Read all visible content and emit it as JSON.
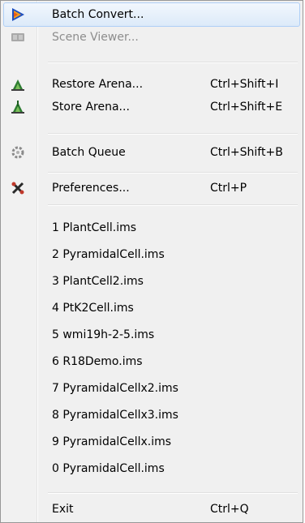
{
  "menu": {
    "items": [
      {
        "id": "batch-convert",
        "label": "Batch Convert...",
        "shortcut": "",
        "icon": "batch-convert-icon",
        "enabled": true,
        "highlighted": true
      },
      {
        "id": "scene-viewer",
        "label": "Scene Viewer...",
        "shortcut": "",
        "icon": "scene-viewer-icon",
        "enabled": false
      },
      {
        "id": "restore-arena",
        "label": "Restore Arena...",
        "shortcut": "Ctrl+Shift+I",
        "icon": "restore-arena-icon",
        "enabled": true
      },
      {
        "id": "store-arena",
        "label": "Store Arena...",
        "shortcut": "Ctrl+Shift+E",
        "icon": "store-arena-icon",
        "enabled": true
      },
      {
        "id": "batch-queue",
        "label": "Batch Queue",
        "shortcut": "Ctrl+Shift+B",
        "icon": "batch-queue-icon",
        "enabled": true
      },
      {
        "id": "preferences",
        "label": "Preferences...",
        "shortcut": "Ctrl+P",
        "icon": "preferences-icon",
        "enabled": true
      }
    ],
    "recent_files": [
      "1 PlantCell.ims",
      "2 PyramidalCell.ims",
      "3 PlantCell2.ims",
      "4 PtK2Cell.ims",
      "5 wmi19h-2-5.ims",
      "6 R18Demo.ims",
      "7 PyramidalCellx2.ims",
      "8 PyramidalCellx3.ims",
      "9 PyramidalCellx.ims",
      "0 PyramidalCell.ims"
    ],
    "exit": {
      "label": "Exit",
      "shortcut": "Ctrl+Q"
    }
  },
  "colors": {
    "highlight_border": "#aecff7",
    "highlight_fill": "#dceaf9",
    "disabled_text": "#8d8d8d",
    "play_icon_blue": "#1e4fbf",
    "play_icon_orange": "#f0a020"
  }
}
